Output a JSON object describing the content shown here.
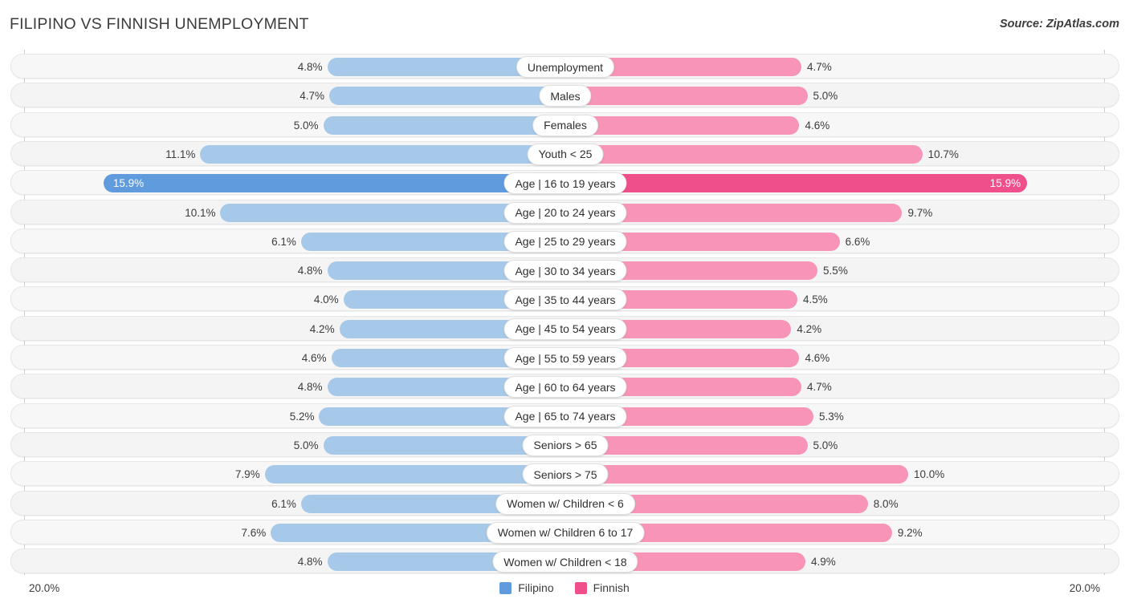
{
  "header": {
    "title": "FILIPINO VS FINNISH UNEMPLOYMENT",
    "source": "Source: ZipAtlas.com"
  },
  "footer": {
    "axis_left": "20.0%",
    "axis_right": "20.0%",
    "legend": [
      {
        "label": "Filipino",
        "color": "#5f9bdd"
      },
      {
        "label": "Finnish",
        "color": "#ef4f8b"
      }
    ]
  },
  "colors": {
    "left_bar": "#a6c9ea",
    "right_bar": "#f794b8",
    "left_bar_highlight": "#5f9bdd",
    "right_bar_highlight": "#ef4f8b",
    "row_track": "#f7f7f7",
    "text": "#3c3c3c"
  },
  "chart_data": {
    "type": "bar",
    "subtype": "diverging-paired-bar",
    "title": "FILIPINO VS FINNISH UNEMPLOYMENT",
    "xlabel": "",
    "ylabel": "",
    "unit": "%",
    "axis_max": 20.0,
    "axis_min": 0.0,
    "grid": false,
    "legend_position": "bottom-center",
    "categories": [
      "Unemployment",
      "Males",
      "Females",
      "Youth < 25",
      "Age | 16 to 19 years",
      "Age | 20 to 24 years",
      "Age | 25 to 29 years",
      "Age | 30 to 34 years",
      "Age | 35 to 44 years",
      "Age | 45 to 54 years",
      "Age | 55 to 59 years",
      "Age | 60 to 64 years",
      "Age | 65 to 74 years",
      "Seniors > 65",
      "Seniors > 75",
      "Women w/ Children < 6",
      "Women w/ Children 6 to 17",
      "Women w/ Children < 18"
    ],
    "series": [
      {
        "name": "Filipino",
        "color": "#5f9bdd",
        "values": [
          4.8,
          4.7,
          5.0,
          11.1,
          15.9,
          10.1,
          6.1,
          4.8,
          4.0,
          4.2,
          4.6,
          4.8,
          5.2,
          5.0,
          7.9,
          6.1,
          7.6,
          4.8
        ]
      },
      {
        "name": "Finnish",
        "color": "#ef4f8b",
        "values": [
          4.7,
          5.0,
          4.6,
          10.7,
          15.9,
          9.7,
          6.6,
          5.5,
          4.5,
          4.2,
          4.6,
          4.7,
          5.3,
          5.0,
          10.0,
          8.0,
          9.2,
          4.9
        ]
      }
    ]
  },
  "rows": [
    {
      "label": "Unemployment",
      "left": "4.8%",
      "right": "4.7%",
      "lv": 4.8,
      "rv": 4.7,
      "highlight": false
    },
    {
      "label": "Males",
      "left": "4.7%",
      "right": "5.0%",
      "lv": 4.7,
      "rv": 5.0,
      "highlight": false
    },
    {
      "label": "Females",
      "left": "5.0%",
      "right": "4.6%",
      "lv": 5.0,
      "rv": 4.6,
      "highlight": false
    },
    {
      "label": "Youth < 25",
      "left": "11.1%",
      "right": "10.7%",
      "lv": 11.1,
      "rv": 10.7,
      "highlight": false
    },
    {
      "label": "Age | 16 to 19 years",
      "left": "15.9%",
      "right": "15.9%",
      "lv": 15.9,
      "rv": 15.9,
      "highlight": true
    },
    {
      "label": "Age | 20 to 24 years",
      "left": "10.1%",
      "right": "9.7%",
      "lv": 10.1,
      "rv": 9.7,
      "highlight": false
    },
    {
      "label": "Age | 25 to 29 years",
      "left": "6.1%",
      "right": "6.6%",
      "lv": 6.1,
      "rv": 6.6,
      "highlight": false
    },
    {
      "label": "Age | 30 to 34 years",
      "left": "4.8%",
      "right": "5.5%",
      "lv": 4.8,
      "rv": 5.5,
      "highlight": false
    },
    {
      "label": "Age | 35 to 44 years",
      "left": "4.0%",
      "right": "4.5%",
      "lv": 4.0,
      "rv": 4.5,
      "highlight": false
    },
    {
      "label": "Age | 45 to 54 years",
      "left": "4.2%",
      "right": "4.2%",
      "lv": 4.2,
      "rv": 4.2,
      "highlight": false
    },
    {
      "label": "Age | 55 to 59 years",
      "left": "4.6%",
      "right": "4.6%",
      "lv": 4.6,
      "rv": 4.6,
      "highlight": false
    },
    {
      "label": "Age | 60 to 64 years",
      "left": "4.8%",
      "right": "4.7%",
      "lv": 4.8,
      "rv": 4.7,
      "highlight": false
    },
    {
      "label": "Age | 65 to 74 years",
      "left": "5.2%",
      "right": "5.3%",
      "lv": 5.2,
      "rv": 5.3,
      "highlight": false
    },
    {
      "label": "Seniors > 65",
      "left": "5.0%",
      "right": "5.0%",
      "lv": 5.0,
      "rv": 5.0,
      "highlight": false
    },
    {
      "label": "Seniors > 75",
      "left": "7.9%",
      "right": "10.0%",
      "lv": 7.9,
      "rv": 10.0,
      "highlight": false
    },
    {
      "label": "Women w/ Children < 6",
      "left": "6.1%",
      "right": "8.0%",
      "lv": 6.1,
      "rv": 8.0,
      "highlight": false
    },
    {
      "label": "Women w/ Children 6 to 17",
      "left": "7.6%",
      "right": "9.2%",
      "lv": 7.6,
      "rv": 9.2,
      "highlight": false
    },
    {
      "label": "Women w/ Children < 18",
      "left": "4.8%",
      "right": "4.9%",
      "lv": 4.8,
      "rv": 4.9,
      "highlight": false
    }
  ]
}
